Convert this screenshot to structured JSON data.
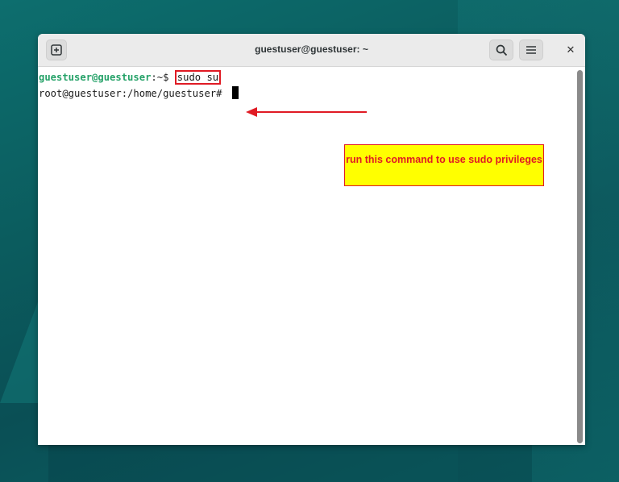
{
  "window": {
    "title": "guestuser@guestuser: ~"
  },
  "terminal": {
    "line1_user": "guestuser@guestuser",
    "line1_path": ":~$ ",
    "line1_command": "sudo su",
    "line2": "root@guestuser:/home/guestuser# "
  },
  "annotation": {
    "text": "run this command to use sudo privileges"
  },
  "icons": {
    "new_tab": "new-tab-icon",
    "search": "search-icon",
    "menu": "hamburger-menu-icon",
    "close": "close-icon"
  },
  "colors": {
    "prompt_user": "#26a269",
    "annotation_bg": "#ffff00",
    "annotation_text": "#e01b24"
  }
}
